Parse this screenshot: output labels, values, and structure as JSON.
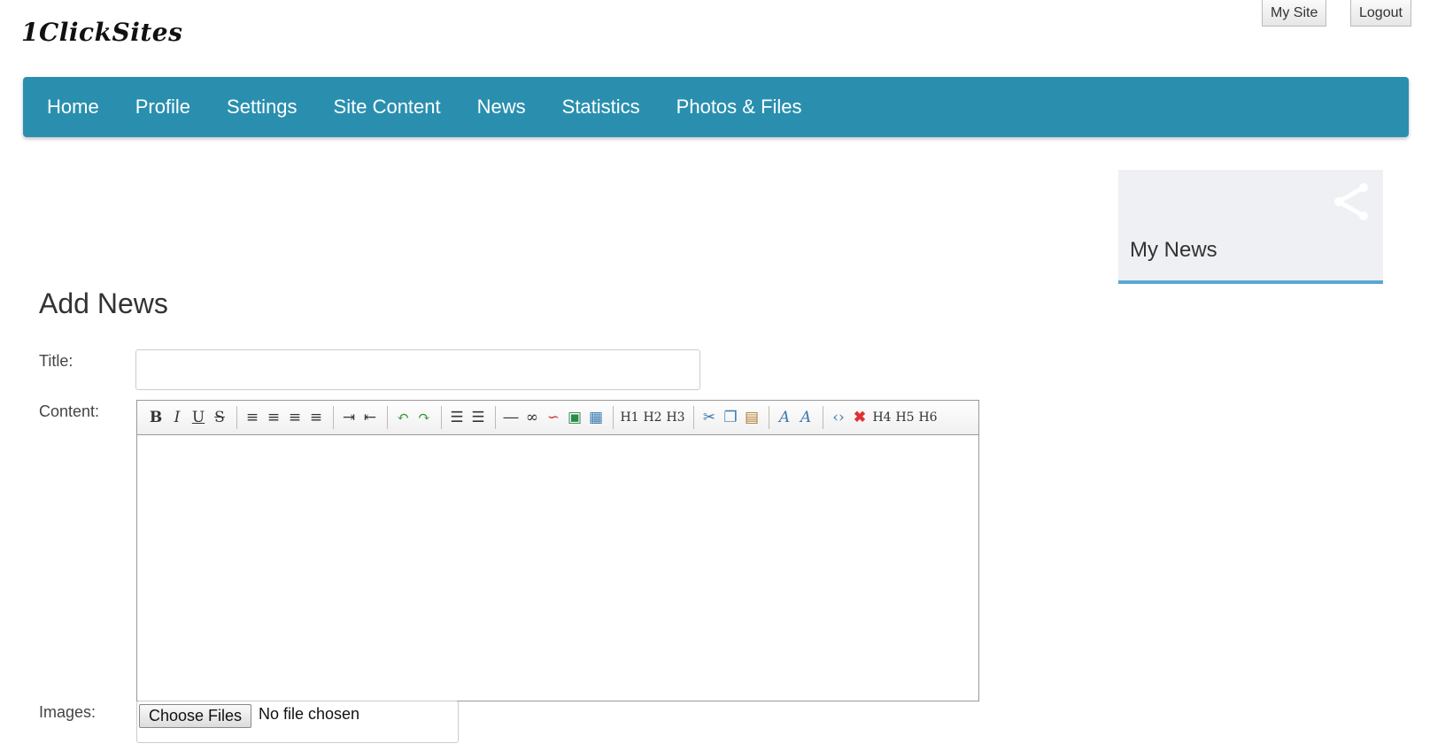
{
  "logo": "1ClickSites",
  "top_buttons": {
    "my_site": "My Site",
    "logout": "Logout"
  },
  "nav": [
    "Home",
    "Profile",
    "Settings",
    "Site Content",
    "News",
    "Statistics",
    "Photos & Files"
  ],
  "sidebar_widget": {
    "title": "My News",
    "icon": "share-icon"
  },
  "page": {
    "title": "Add News",
    "labels": {
      "title": "Title:",
      "content": "Content:",
      "images": "Images:"
    },
    "title_value": ""
  },
  "editor": {
    "toolbar": {
      "bold": "B",
      "italic": "I",
      "underline": "U",
      "strike": "S",
      "h1": "H1",
      "h2": "H2",
      "h3": "H3",
      "h4": "H4",
      "h5": "H5",
      "h6": "H6"
    },
    "content": ""
  },
  "file_input": {
    "button": "Choose Files",
    "status": "No file chosen"
  },
  "colors": {
    "nav_bg": "#2a8faf",
    "widget_border": "#5aa6d8",
    "widget_bg": "#eef0f3"
  }
}
